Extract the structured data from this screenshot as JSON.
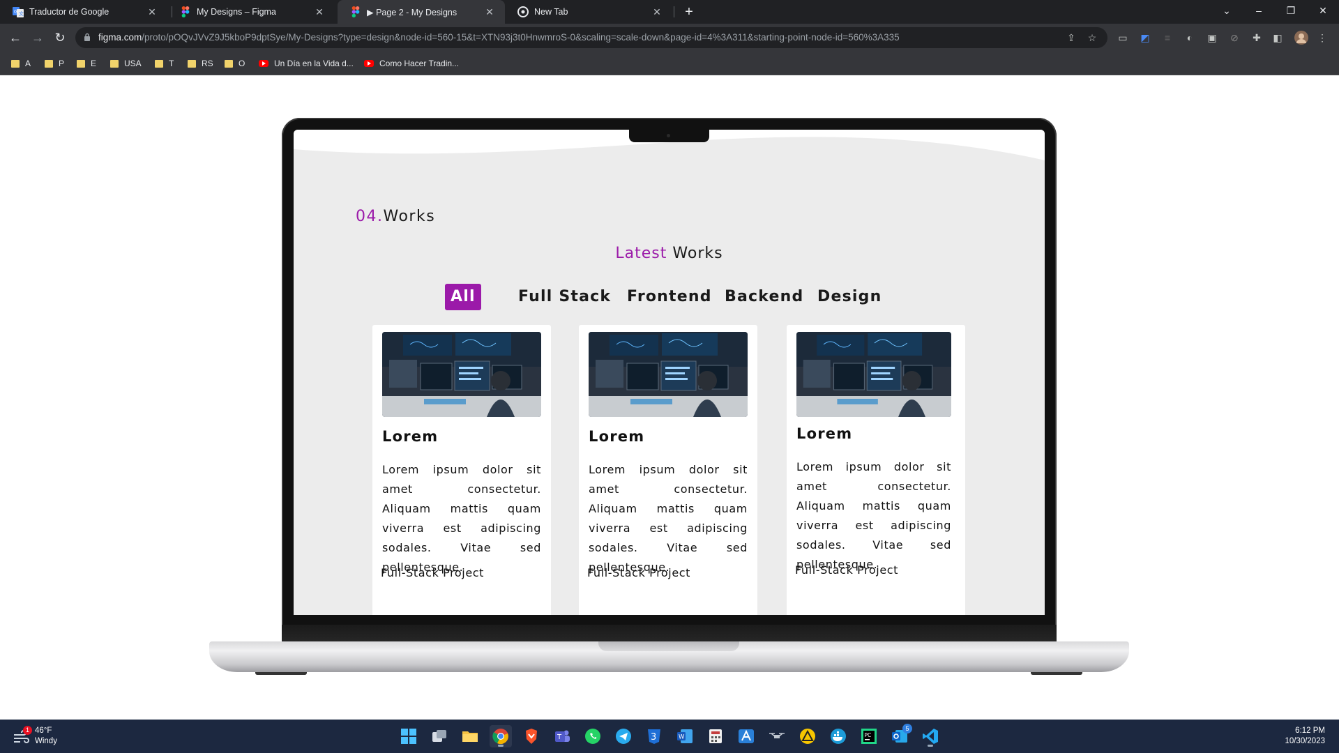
{
  "browser": {
    "tabs": [
      {
        "title": "Traductor de Google",
        "icon": "google-translate-icon",
        "active": false
      },
      {
        "title": "My Designs – Figma",
        "icon": "figma-icon",
        "active": false
      },
      {
        "title": "▶ Page 2 - My Designs",
        "icon": "figma-icon",
        "active": true
      },
      {
        "title": "New Tab",
        "icon": "chrome-icon",
        "active": false
      }
    ],
    "url_host": "figma.com",
    "url_rest": "/proto/pOQvJVvZ9J5kboP9dptSye/My-Designs?type=design&node-id=560-15&t=XTN93j3t0HnwmroS-0&scaling=scale-down&page-id=4%3A311&starting-point-node-id=560%3A335",
    "bookmarks": [
      {
        "label": "A",
        "type": "folder"
      },
      {
        "label": "P",
        "type": "folder"
      },
      {
        "label": "E",
        "type": "folder"
      },
      {
        "label": "USA",
        "type": "folder"
      },
      {
        "label": "T",
        "type": "folder"
      },
      {
        "label": "RS",
        "type": "folder"
      },
      {
        "label": "O",
        "type": "folder"
      },
      {
        "label": "Un Día en la Vida d...",
        "type": "youtube"
      },
      {
        "label": "Como Hacer Tradin...",
        "type": "youtube"
      }
    ]
  },
  "works": {
    "section_number": "04.",
    "section_label": "Works",
    "title_accent": "Latest",
    "title_rest": "Works",
    "filters": [
      "All",
      "Full Stack",
      "Frontend",
      "Backend",
      "Design"
    ],
    "active_filter": "All",
    "accent_color": "#9b1aa9",
    "cards": [
      {
        "title": "Lorem",
        "body": "Lorem ipsum dolor sit amet consectetur. Aliquam mattis quam viverra est adipiscing sodales. Vitae sed pellentesque.",
        "footer": "Full-Stack Project"
      },
      {
        "title": "Lorem",
        "body": "Lorem ipsum dolor sit amet consectetur. Aliquam mattis quam viverra est adipiscing sodales. Vitae sed pellentesque.",
        "footer": "Full-Stack Project"
      },
      {
        "title": "Lorem",
        "body": "Lorem ipsum dolor sit amet consectetur. Aliquam mattis quam viverra est adipiscing sodales. Vitae sed pellentesque.",
        "footer": "Full-Stack Project"
      }
    ]
  },
  "taskbar": {
    "weather_temp": "46°F",
    "weather_desc": "Windy",
    "weather_badge": "1",
    "teams_badge": "5",
    "time": "6:12 PM",
    "date": "10/30/2023"
  }
}
